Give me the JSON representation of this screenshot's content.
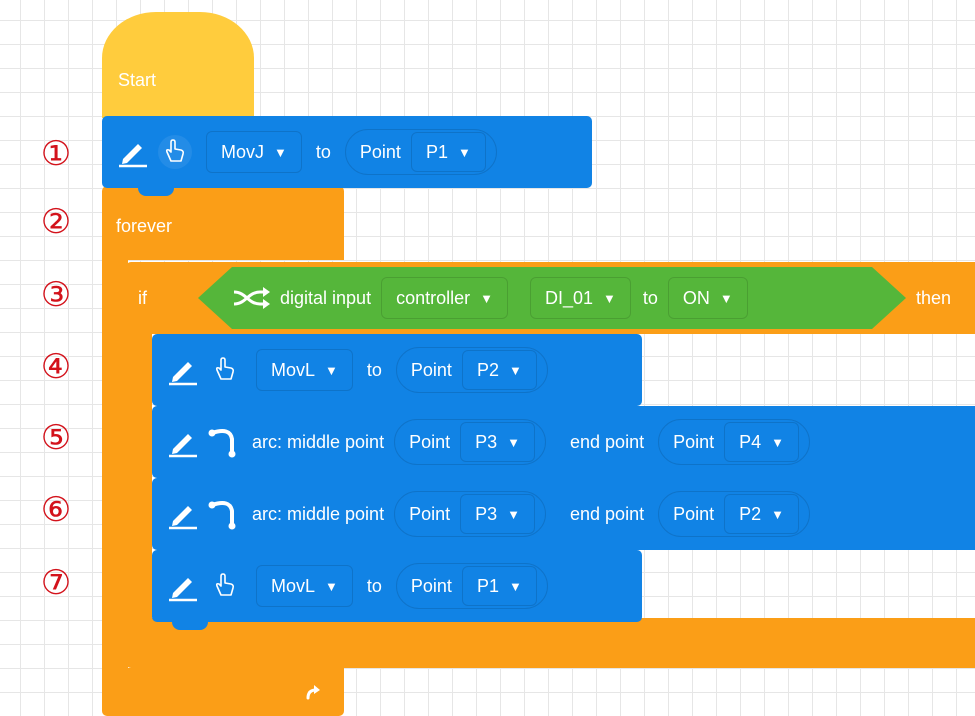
{
  "annotations": [
    "①",
    "②",
    "③",
    "④",
    "⑤",
    "⑥",
    "⑦"
  ],
  "start": {
    "label": "Start"
  },
  "step1": {
    "motion": "MovJ",
    "to": "to",
    "point_label": "Point",
    "point": "P1"
  },
  "forever": {
    "label": "forever"
  },
  "if_block": {
    "if_label": "if",
    "then_label": "then",
    "condition": {
      "label": "digital input",
      "source": "controller",
      "port": "DI_01",
      "to": "to",
      "state": "ON"
    }
  },
  "step4": {
    "motion": "MovL",
    "to": "to",
    "point_label": "Point",
    "point": "P2"
  },
  "step5": {
    "arc_label": "arc: middle point",
    "mid_label": "Point",
    "mid": "P3",
    "end_label": "end point",
    "end_point_label": "Point",
    "end": "P4"
  },
  "step6": {
    "arc_label": "arc: middle point",
    "mid_label": "Point",
    "mid": "P3",
    "end_label": "end point",
    "end_point_label": "Point",
    "end": "P2"
  },
  "step7": {
    "motion": "MovL",
    "to": "to",
    "point_label": "Point",
    "point": "P1"
  },
  "colors": {
    "hat": "#ffcc3d",
    "control": "#fb9e17",
    "motion": "#1183e5",
    "sensor": "#55b63a",
    "annotation": "#d3121b"
  },
  "icons": [
    "pencil-icon",
    "cursor-hand-icon",
    "arc-icon",
    "shuffle-icon",
    "caret-down-icon",
    "loop-arrow-icon"
  ]
}
